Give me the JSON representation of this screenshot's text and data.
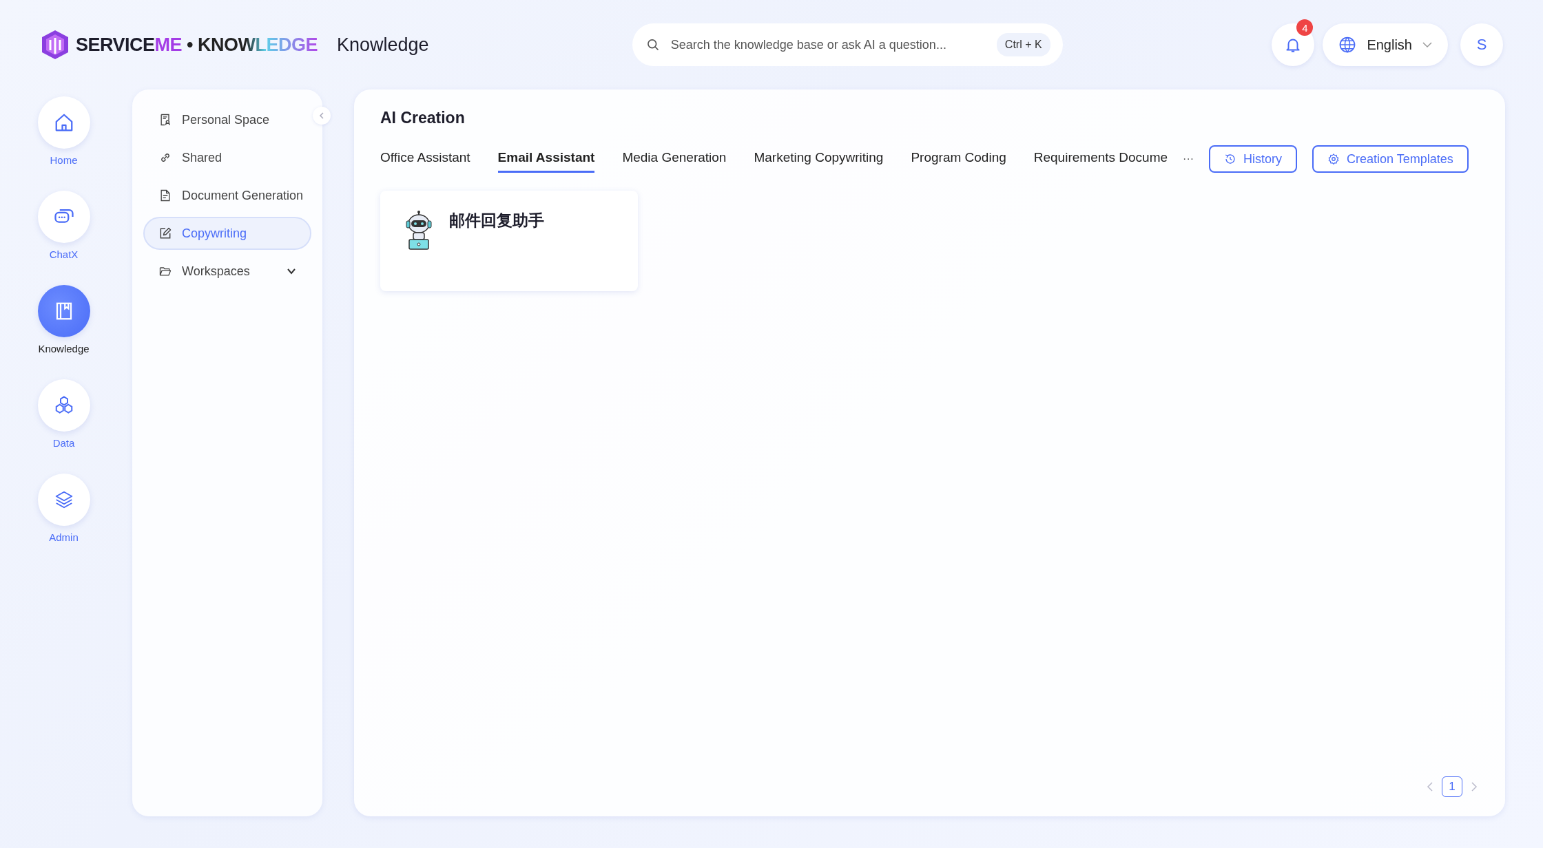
{
  "header": {
    "logo": {
      "brand": "SERVICE",
      "brand_accent": "ME",
      "product": "• KNOWLEDGE"
    },
    "title": "Knowledge",
    "search": {
      "placeholder": "Search the knowledge base or ask AI a question...",
      "shortcut": "Ctrl + K"
    },
    "notifications": {
      "count": "4"
    },
    "language": "English",
    "avatar": "S"
  },
  "nav": [
    {
      "label": "Home",
      "selected": false
    },
    {
      "label": "ChatX",
      "selected": false
    },
    {
      "label": "Knowledge",
      "selected": true
    },
    {
      "label": "Data",
      "selected": false
    },
    {
      "label": "Admin",
      "selected": false
    }
  ],
  "sidebar": {
    "items": [
      {
        "label": "Personal Space",
        "selected": false
      },
      {
        "label": "Shared",
        "selected": false
      },
      {
        "label": "Document Generation",
        "selected": false
      },
      {
        "label": "Copywriting",
        "selected": true
      },
      {
        "label": "Workspaces",
        "selected": false,
        "expanded": false
      }
    ]
  },
  "main": {
    "title": "AI Creation",
    "tabs": [
      {
        "label": "Office Assistant",
        "selected": false
      },
      {
        "label": "Email Assistant",
        "selected": true
      },
      {
        "label": "Media Generation",
        "selected": false
      },
      {
        "label": "Marketing Copywriting",
        "selected": false
      },
      {
        "label": "Program Coding",
        "selected": false
      },
      {
        "label": "Requirements Docume",
        "selected": false
      }
    ],
    "more": "···",
    "buttons": [
      {
        "label": "History"
      },
      {
        "label": "Creation Templates"
      }
    ],
    "cards": [
      {
        "title": "邮件回复助手"
      }
    ],
    "pagination": {
      "pages": [
        {
          "label": "1",
          "selected": true
        }
      ]
    }
  }
}
